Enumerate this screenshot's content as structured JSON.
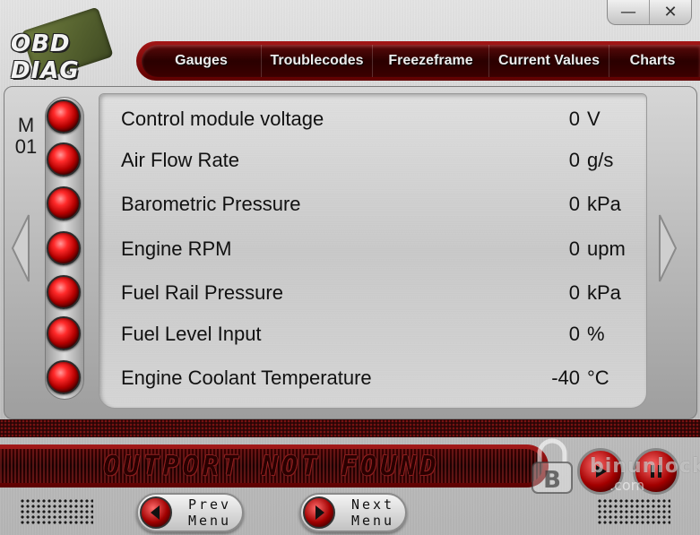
{
  "app": {
    "logo_text": "OBD DIAG",
    "window_controls": {
      "minimize": "—",
      "close": "✕"
    }
  },
  "nav": {
    "tabs": [
      {
        "label": "Gauges"
      },
      {
        "label": "Troublecodes"
      },
      {
        "label": "Freezeframe"
      },
      {
        "label": "Current Values"
      },
      {
        "label": "Charts"
      }
    ]
  },
  "mode": {
    "line1": "M",
    "line2": "01"
  },
  "values": {
    "rows": [
      {
        "label": "Control module voltage",
        "value": "0",
        "unit": "V"
      },
      {
        "label": "Air Flow Rate",
        "value": "0",
        "unit": "g/s"
      },
      {
        "label": "Barometric Pressure",
        "value": "0",
        "unit": "kPa"
      },
      {
        "label": "Engine RPM",
        "value": "0",
        "unit": "upm"
      },
      {
        "label": "Fuel Rail Pressure",
        "value": "0",
        "unit": "kPa"
      },
      {
        "label": "Fuel Level Input",
        "value": "0",
        "unit": "%"
      },
      {
        "label": "Engine Coolant Temperature",
        "value": "-40",
        "unit": "°C"
      }
    ]
  },
  "status": {
    "text": "OUTPORT NOT FOUND"
  },
  "buttons": {
    "prev": {
      "line1": "Prev",
      "line2": "Menu"
    },
    "next": {
      "line1": "Next",
      "line2": "Menu"
    }
  },
  "watermark": {
    "text": "binunlock",
    "sub": ".com"
  },
  "colors": {
    "accent": "#a31616",
    "led": "#ff2a2a"
  }
}
